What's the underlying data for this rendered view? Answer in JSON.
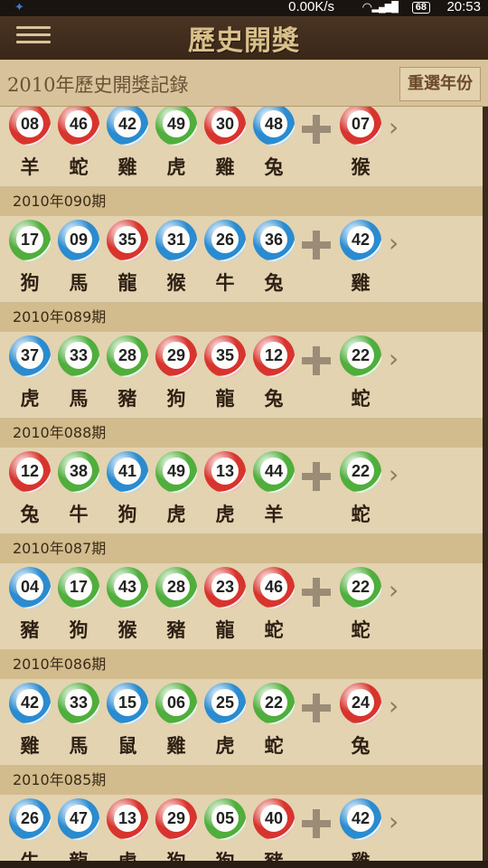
{
  "status_bar": {
    "network_speed": "0.00K/s",
    "battery": "68",
    "time": "20:53"
  },
  "app_bar": {
    "title": "歷史開獎"
  },
  "sub_header": {
    "title": "2010年歷史開獎記錄",
    "reselect_label": "重選年份"
  },
  "colors": {
    "red": "#d8342e",
    "blue": "#2a8bd0",
    "green": "#4fae3c"
  },
  "draws": [
    {
      "period": "",
      "balls": [
        {
          "num": "08",
          "color": "red",
          "zodiac": "羊"
        },
        {
          "num": "46",
          "color": "red",
          "zodiac": "蛇"
        },
        {
          "num": "42",
          "color": "blue",
          "zodiac": "雞"
        },
        {
          "num": "49",
          "color": "green",
          "zodiac": "虎"
        },
        {
          "num": "30",
          "color": "red",
          "zodiac": "雞"
        },
        {
          "num": "48",
          "color": "blue",
          "zodiac": "兔"
        }
      ],
      "special": {
        "num": "07",
        "color": "red",
        "zodiac": "猴"
      }
    },
    {
      "period": "2010年090期",
      "balls": [
        {
          "num": "17",
          "color": "green",
          "zodiac": "狗"
        },
        {
          "num": "09",
          "color": "blue",
          "zodiac": "馬"
        },
        {
          "num": "35",
          "color": "red",
          "zodiac": "龍"
        },
        {
          "num": "31",
          "color": "blue",
          "zodiac": "猴"
        },
        {
          "num": "26",
          "color": "blue",
          "zodiac": "牛"
        },
        {
          "num": "36",
          "color": "blue",
          "zodiac": "兔"
        }
      ],
      "special": {
        "num": "42",
        "color": "blue",
        "zodiac": "雞"
      }
    },
    {
      "period": "2010年089期",
      "balls": [
        {
          "num": "37",
          "color": "blue",
          "zodiac": "虎"
        },
        {
          "num": "33",
          "color": "green",
          "zodiac": "馬"
        },
        {
          "num": "28",
          "color": "green",
          "zodiac": "豬"
        },
        {
          "num": "29",
          "color": "red",
          "zodiac": "狗"
        },
        {
          "num": "35",
          "color": "red",
          "zodiac": "龍"
        },
        {
          "num": "12",
          "color": "red",
          "zodiac": "兔"
        }
      ],
      "special": {
        "num": "22",
        "color": "green",
        "zodiac": "蛇"
      }
    },
    {
      "period": "2010年088期",
      "balls": [
        {
          "num": "12",
          "color": "red",
          "zodiac": "兔"
        },
        {
          "num": "38",
          "color": "green",
          "zodiac": "牛"
        },
        {
          "num": "41",
          "color": "blue",
          "zodiac": "狗"
        },
        {
          "num": "49",
          "color": "green",
          "zodiac": "虎"
        },
        {
          "num": "13",
          "color": "red",
          "zodiac": "虎"
        },
        {
          "num": "44",
          "color": "green",
          "zodiac": "羊"
        }
      ],
      "special": {
        "num": "22",
        "color": "green",
        "zodiac": "蛇"
      }
    },
    {
      "period": "2010年087期",
      "balls": [
        {
          "num": "04",
          "color": "blue",
          "zodiac": "豬"
        },
        {
          "num": "17",
          "color": "green",
          "zodiac": "狗"
        },
        {
          "num": "43",
          "color": "green",
          "zodiac": "猴"
        },
        {
          "num": "28",
          "color": "green",
          "zodiac": "豬"
        },
        {
          "num": "23",
          "color": "red",
          "zodiac": "龍"
        },
        {
          "num": "46",
          "color": "red",
          "zodiac": "蛇"
        }
      ],
      "special": {
        "num": "22",
        "color": "green",
        "zodiac": "蛇"
      }
    },
    {
      "period": "2010年086期",
      "balls": [
        {
          "num": "42",
          "color": "blue",
          "zodiac": "雞"
        },
        {
          "num": "33",
          "color": "green",
          "zodiac": "馬"
        },
        {
          "num": "15",
          "color": "blue",
          "zodiac": "鼠"
        },
        {
          "num": "06",
          "color": "green",
          "zodiac": "雞"
        },
        {
          "num": "25",
          "color": "blue",
          "zodiac": "虎"
        },
        {
          "num": "22",
          "color": "green",
          "zodiac": "蛇"
        }
      ],
      "special": {
        "num": "24",
        "color": "red",
        "zodiac": "兔"
      }
    },
    {
      "period": "2010年085期",
      "balls": [
        {
          "num": "26",
          "color": "blue",
          "zodiac": "牛"
        },
        {
          "num": "47",
          "color": "blue",
          "zodiac": "龍"
        },
        {
          "num": "13",
          "color": "red",
          "zodiac": "虎"
        },
        {
          "num": "29",
          "color": "red",
          "zodiac": "狗"
        },
        {
          "num": "05",
          "color": "green",
          "zodiac": "狗"
        },
        {
          "num": "40",
          "color": "red",
          "zodiac": "豬"
        }
      ],
      "special": {
        "num": "42",
        "color": "blue",
        "zodiac": "雞"
      }
    }
  ]
}
